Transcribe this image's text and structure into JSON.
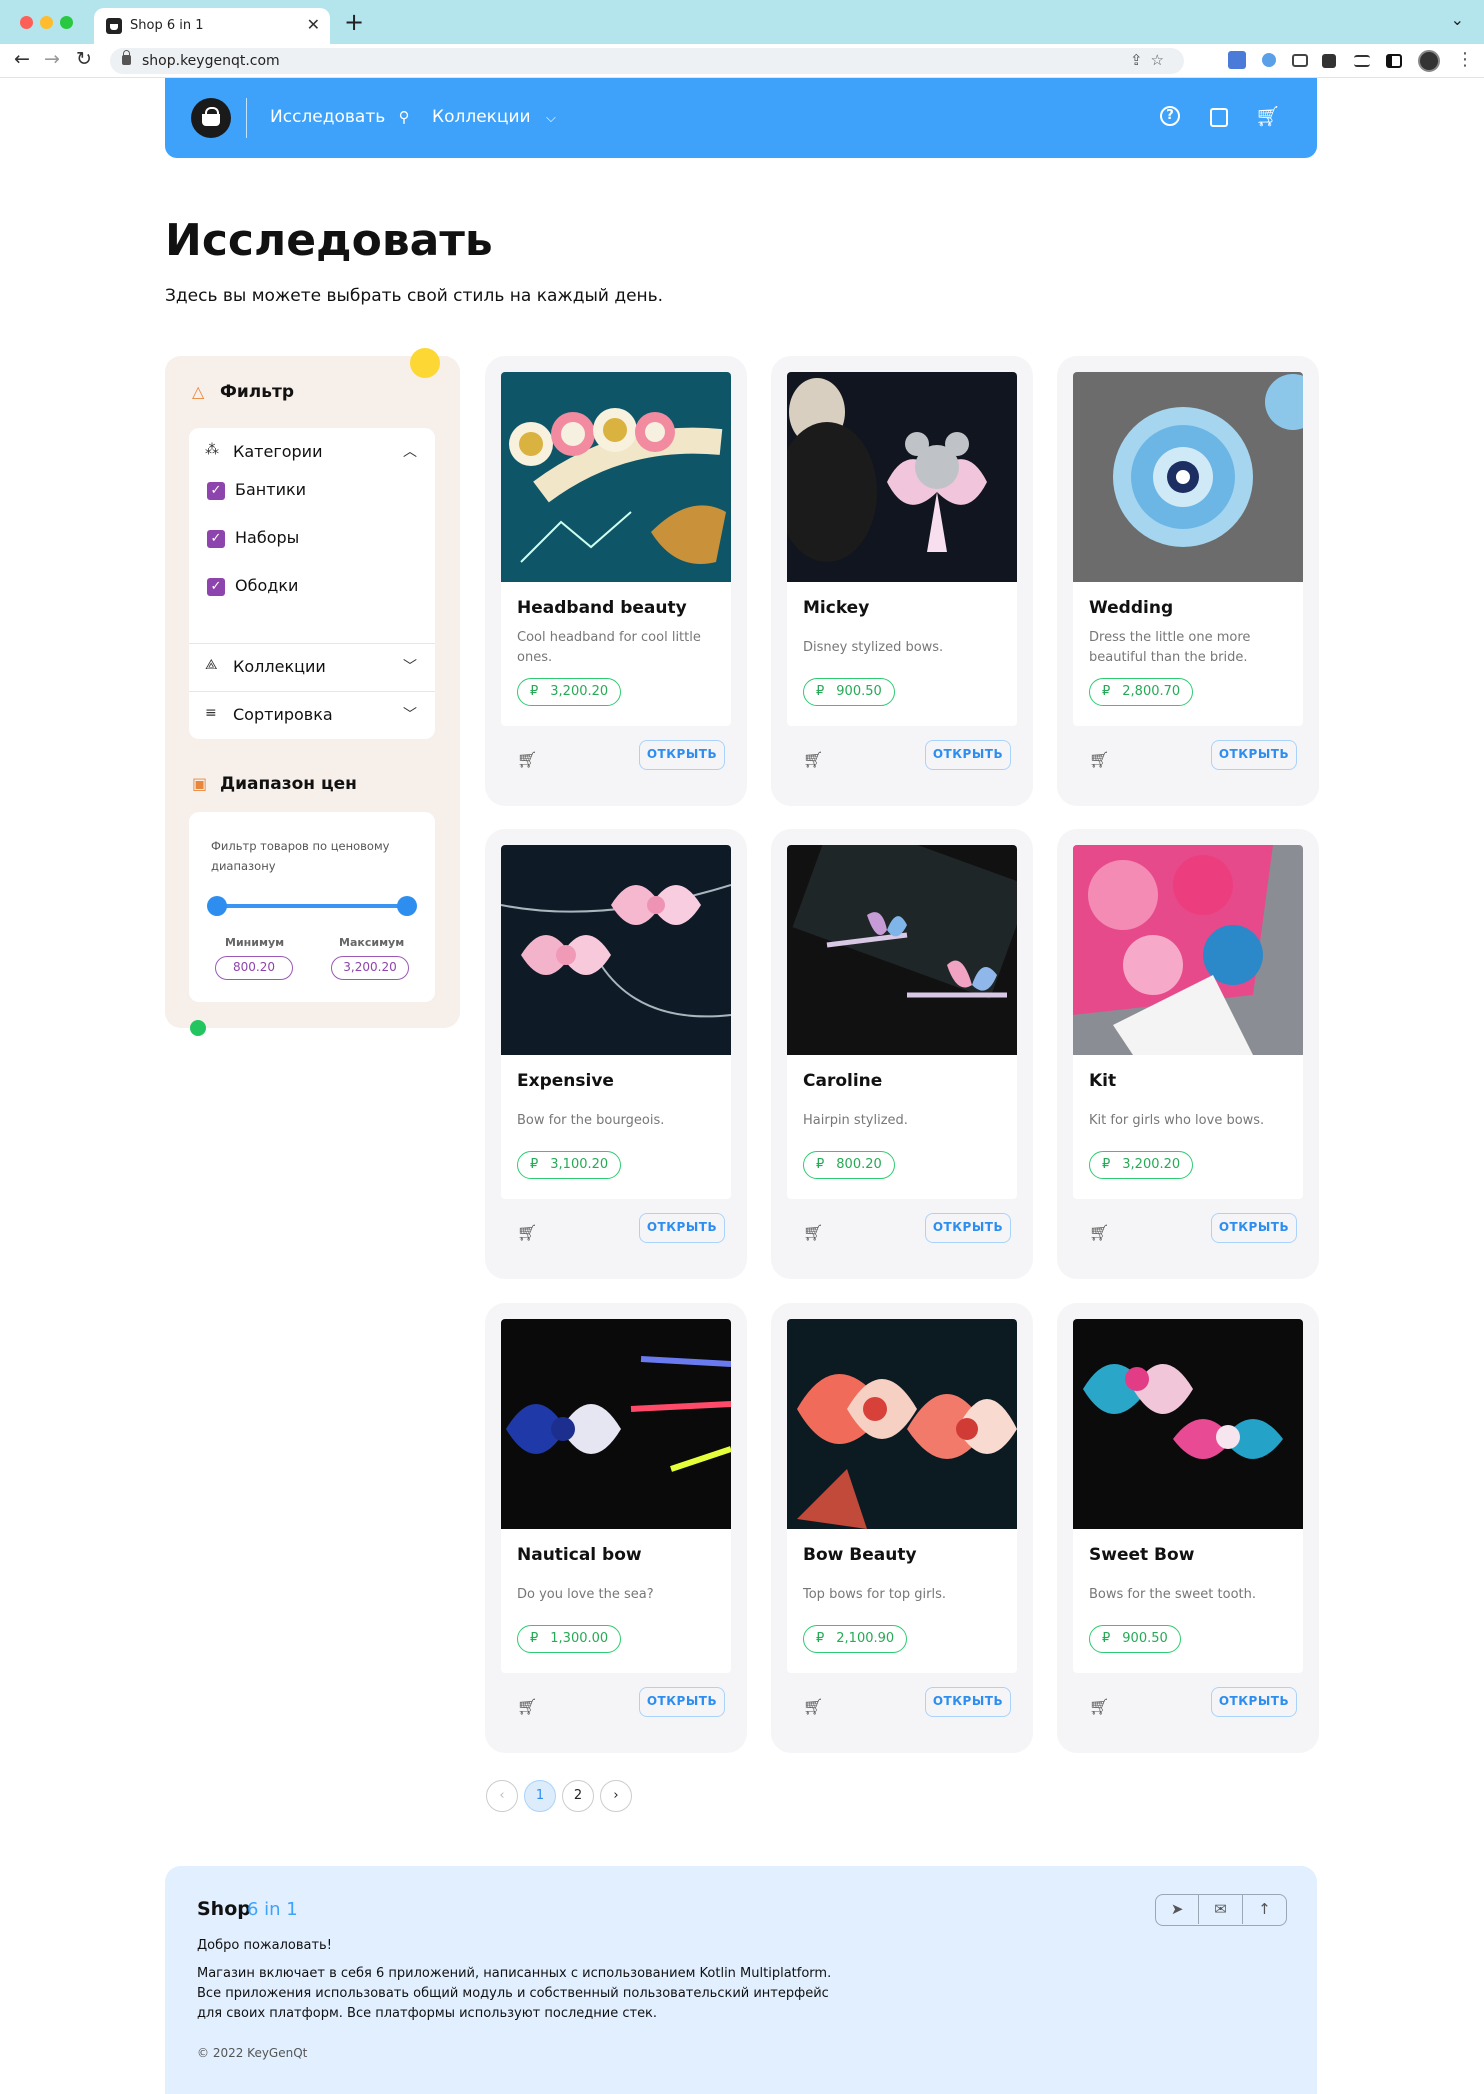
{
  "browser": {
    "tab_title": "Shop 6 in 1",
    "url": "shop.keygenqt.com"
  },
  "header": {
    "explore_label": "Исследовать",
    "collections_label": "Коллекции",
    "accent_color": "#3ea2fb"
  },
  "page": {
    "title": "Исследовать",
    "subtitle": "Здесь вы можете выбрать свой стиль на каждый день."
  },
  "filter": {
    "title": "Фильтр",
    "categories_label": "Категории",
    "categories": [
      {
        "label": "Бантики",
        "checked": true
      },
      {
        "label": "Наборы",
        "checked": true
      },
      {
        "label": "Ободки",
        "checked": true
      }
    ],
    "collections_label": "Коллекции",
    "sort_label": "Сортировка"
  },
  "price_range": {
    "title": "Диапазон цен",
    "caption": "Фильтр товаров по ценовому диапазону",
    "min_label": "Минимум",
    "max_label": "Максимум",
    "min_value": "800.20",
    "max_value": "3,200.20"
  },
  "currency_symbol": "₽",
  "open_label": "ОТКРЫТЬ",
  "products": [
    {
      "name": "Headband beauty",
      "description": "Cool headband for cool little ones.",
      "price": "3,200.20",
      "image": "headband-photo"
    },
    {
      "name": "Mickey",
      "description": "Disney stylized bows.",
      "price": "900.50",
      "image": "mickey-bow-photo"
    },
    {
      "name": "Wedding",
      "description": "Dress the little one more beautiful than the bride.",
      "price": "2,800.70",
      "image": "blue-flower-photo"
    },
    {
      "name": "Expensive",
      "description": "Bow for the bourgeois.",
      "price": "3,100.20",
      "image": "pink-bows-photo"
    },
    {
      "name": "Caroline",
      "description": "Hairpin stylized.",
      "price": "800.20",
      "image": "butterfly-hairpin-photo"
    },
    {
      "name": "Kit",
      "description": "Kit for girls who love bows.",
      "price": "3,200.20",
      "image": "bow-kit-photo"
    },
    {
      "name": "Nautical bow",
      "description": "Do you love the sea?",
      "price": "1,300.00",
      "image": "nautical-bow-photo"
    },
    {
      "name": "Bow Beauty",
      "description": "Top bows for top girls.",
      "price": "2,100.90",
      "image": "red-bows-photo"
    },
    {
      "name": "Sweet Bow",
      "description": "Bows for the sweet tooth.",
      "price": "900.50",
      "image": "sweet-bows-photo"
    }
  ],
  "pagination": {
    "pages": [
      "1",
      "2"
    ],
    "current": "1"
  },
  "footer": {
    "brand": "Shop",
    "brand_accent": "6 in 1",
    "welcome": "Добро пожаловать!",
    "lines": [
      "Магазин включает в себя 6 приложений, написанных с использованием Kotlin Multiplatform.",
      "Все приложения использовать общий модуль и собственный пользовательский интерфейс",
      "для своих платформ. Все платформы используют последние стек."
    ],
    "copyright": "© 2022 KeyGenQt"
  }
}
